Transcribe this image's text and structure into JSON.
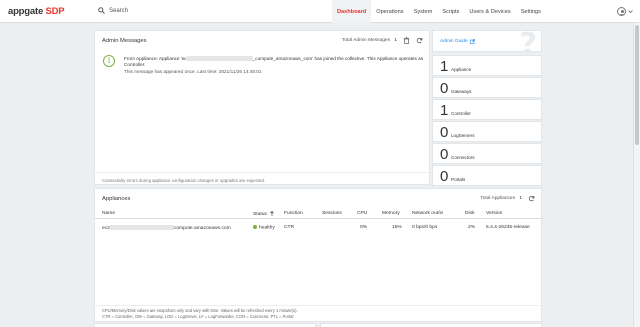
{
  "header": {
    "logo_main": "appgate",
    "logo_accent": "SDP",
    "search_placeholder": "Search",
    "nav": [
      {
        "label": "Dashboard",
        "active": true
      },
      {
        "label": "Operations"
      },
      {
        "label": "System"
      },
      {
        "label": "Scripts"
      },
      {
        "label": "Users & Devices"
      },
      {
        "label": "Settings"
      }
    ],
    "user_icon": "user-circle-icon"
  },
  "admin_messages": {
    "title": "Admin Messages",
    "total_label": "Total Admin Messages",
    "total_value": "1",
    "message_prefix": "From Appliance: Appliance 'ec",
    "message_suffix": "_compute_amazonaws_com' has joined the collective. This Appliance operates as Controller.",
    "meta": "This message has appeared once. Last time: 2021/11/26 14:45:01",
    "footer": "Connectivity errors during appliance configuration changes or upgrades are expected."
  },
  "admin_guide": {
    "label": "Admin Guide"
  },
  "stats": [
    {
      "value": "1",
      "label": "Appliance"
    },
    {
      "value": "0",
      "label": "Gateways"
    },
    {
      "value": "1",
      "label": "Controller"
    },
    {
      "value": "0",
      "label": "LogServers"
    },
    {
      "value": "0",
      "label": "Connectors"
    },
    {
      "value": "0",
      "label": "Portals"
    }
  ],
  "appliances": {
    "title": "Appliances",
    "total_label": "Total Appliances",
    "total_value": "1",
    "columns": {
      "name": "Name",
      "status": "Status",
      "function": "Function",
      "sessions": "Sessions",
      "cpu": "CPU",
      "memory": "Memory",
      "network": "Network out/in",
      "disk": "Disk",
      "version": "Version"
    },
    "rows": [
      {
        "name_prefix": "ec2",
        "name_suffix": "compute.amazonaws.com",
        "status": "healthy",
        "function": "CTR",
        "sessions": "",
        "cpu": "0%",
        "memory": "16%",
        "network": "0 bps/0 bps",
        "disk": "2%",
        "version": "5.4.4-26245-release"
      }
    ],
    "footer_line1": "CPU/Memory/Disk values are snapshots only and vary with time. Values will be refreshed every 1 minute(s).",
    "footer_line2": "CTR = Controller, GW = Gateway, LOG = LogServer, LF = LogForwarder, CON = Connector, PTL = Portal"
  }
}
